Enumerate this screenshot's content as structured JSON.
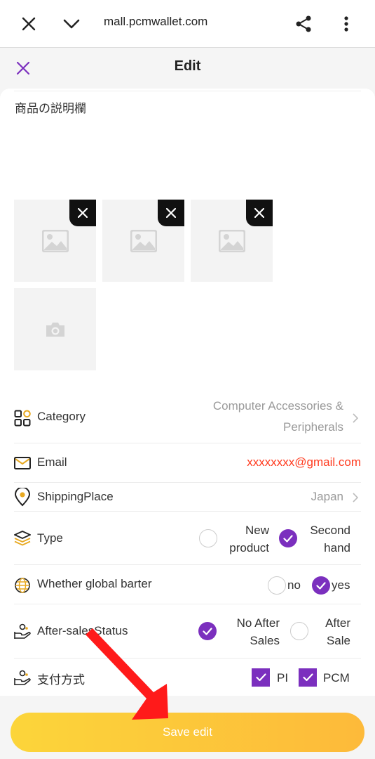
{
  "browser": {
    "url": "mall.pcmwallet.com"
  },
  "header": {
    "title": "Edit"
  },
  "description": {
    "text": "商品の説明欄"
  },
  "icons": {
    "close": "close-icon",
    "collapse": "chevron-down-icon",
    "share": "share-icon",
    "more": "more-vert-icon",
    "image": "image-placeholder-icon",
    "camera": "camera-icon"
  },
  "colors": {
    "accent": "#7b2fbe",
    "email": "#ff3b1f",
    "button_start": "#fcd53a",
    "button_end": "#fdba3a",
    "arrow": "#ff1a1a"
  },
  "form": {
    "category": {
      "label": "Category",
      "value_line1": "Computer Accessories &",
      "value_line2": "Peripherals"
    },
    "email": {
      "label": "Email",
      "value": "xxxxxxxx@gmail.com"
    },
    "shipping": {
      "label": "ShippingPlace",
      "value": "Japan"
    },
    "type": {
      "label": "Type",
      "option1_line1": "New",
      "option1_line2": "product",
      "option2_line1": "Second",
      "option2_line2": "hand",
      "selected": "Second hand"
    },
    "barter": {
      "label": "Whether global barter",
      "option_no": "no",
      "option_yes": "yes",
      "selected": "yes"
    },
    "after_sales": {
      "label": "After-salesStatus",
      "option1_line1": "No After",
      "option1_line2": "Sales",
      "option2_line1": "After",
      "option2_line2": "Sale",
      "selected": "No After Sales"
    },
    "payment": {
      "label": "支付方式",
      "option1": "PI",
      "option2": "PCM",
      "checked": [
        "PI",
        "PCM"
      ]
    }
  },
  "actions": {
    "save": "Save edit"
  }
}
